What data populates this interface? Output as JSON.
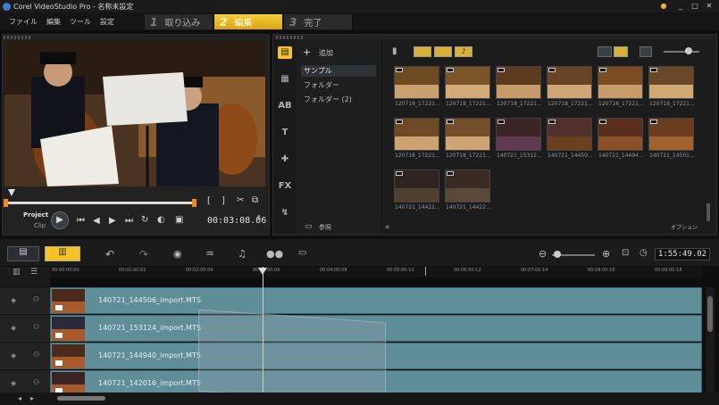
{
  "window": {
    "title": "Corel VideoStudio Pro - 名称未設定",
    "minimize": "_",
    "maximize": "□",
    "close": "✕"
  },
  "menu": [
    "ファイル",
    "編集",
    "ツール",
    "設定"
  ],
  "steps": [
    {
      "num": "1",
      "label": "取り込み"
    },
    {
      "num": "2",
      "label": "編集"
    },
    {
      "num": "3",
      "label": "完了"
    }
  ],
  "preview": {
    "mark_in": "[",
    "mark_out": "]",
    "project": "Project",
    "clip": "Clip",
    "timecode": "00:03:08.06"
  },
  "library": {
    "add_label": "追加",
    "folders": [
      "サンプル",
      "フォルダー",
      "フォルダー (2)"
    ],
    "browse_label": "参照",
    "options_label": "オプション",
    "thumbnails": [
      "120718_17221...",
      "120718_17221...",
      "120718_17221...",
      "120718_17221...",
      "120718_17221...",
      "120718_17221...",
      "120718_17221...",
      "120718_17221...",
      "140721_15312...",
      "140721_14450...",
      "140721_14494...",
      "140721_14501...",
      "140721_14422...",
      "140721_14422..."
    ]
  },
  "timeline": {
    "duration": "1:55:49.02",
    "ruler": [
      "00:00:00:00",
      "00:01:00:02",
      "00:02:00:04",
      "00:03:00:06",
      "00:04:00:08",
      "00:05:00:10",
      "00:06:00:12",
      "00:07:00:14",
      "00:08:00:16",
      "00:09:00:18"
    ],
    "tracks": [
      "140721_144506_import.MTS",
      "140721_153124_import.MTS",
      "140721_144940_import.MTS",
      "140721_142016_import.MTS"
    ]
  },
  "colors": {
    "accent": "#f5c22c",
    "track": "#5f8d98",
    "bg": "#0e0e0e"
  }
}
